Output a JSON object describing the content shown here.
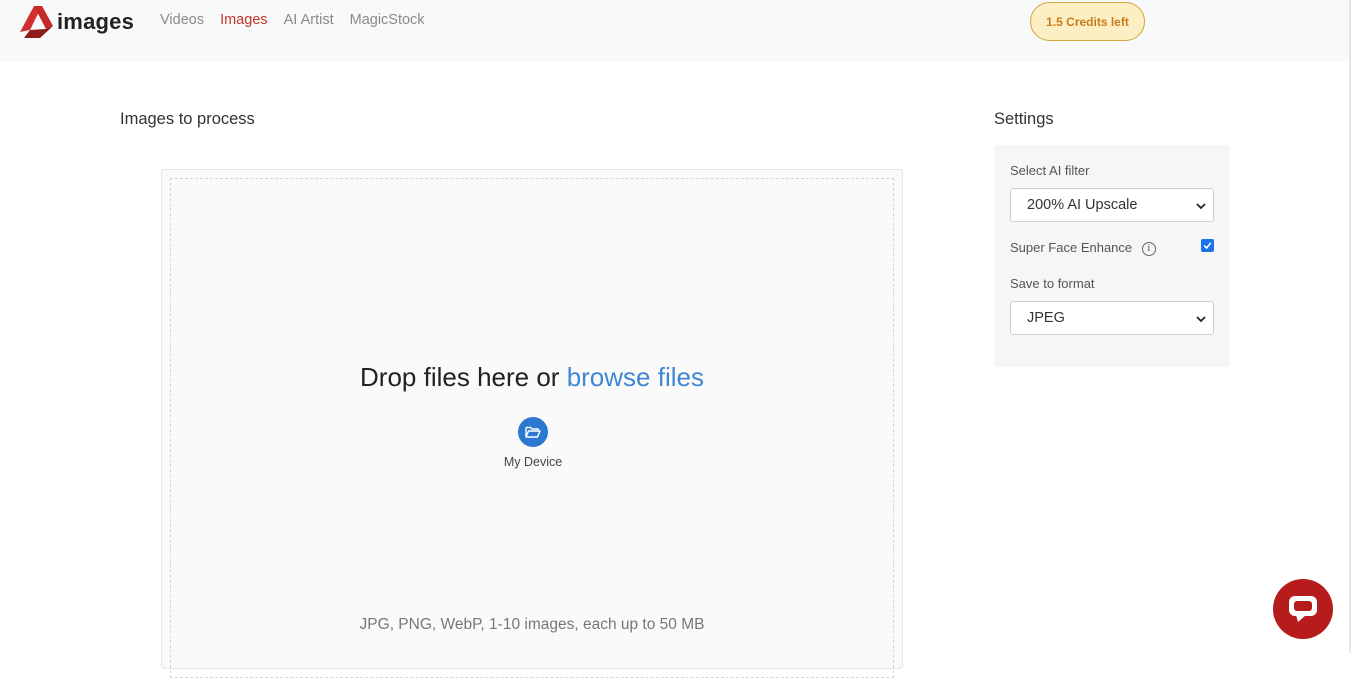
{
  "brand": {
    "logo_text": "images"
  },
  "nav": {
    "items": [
      "Videos",
      "Images",
      "AI Artist",
      "MagicStock"
    ],
    "active": "Images"
  },
  "credits": {
    "label": "1.5 Credits left"
  },
  "upload": {
    "title": "Images to process",
    "drop_text": "Drop files here or",
    "browse_text": "browse files",
    "device_label": "My Device",
    "hint": "JPG, PNG, WebP, 1-10 images, each up to 50 MB"
  },
  "settings": {
    "title": "Settings",
    "filter_label": "Select AI filter",
    "filter_value": "200% AI Upscale",
    "face_enhance_label": "Super Face Enhance",
    "face_enhance_checked": true,
    "format_label": "Save to format",
    "format_value": "JPEG"
  },
  "colors": {
    "accent": "#c0392b",
    "link": "#3f86d6",
    "device": "#2b78d1",
    "chat": "#b71c1c",
    "credits_bg": "#fdefc4"
  },
  "icons": {
    "logo": "brand-a-icon",
    "folder": "folder-open-icon",
    "chat": "chat-bubble-icon",
    "info": "info-icon",
    "chevron": "chevron-down-icon"
  }
}
